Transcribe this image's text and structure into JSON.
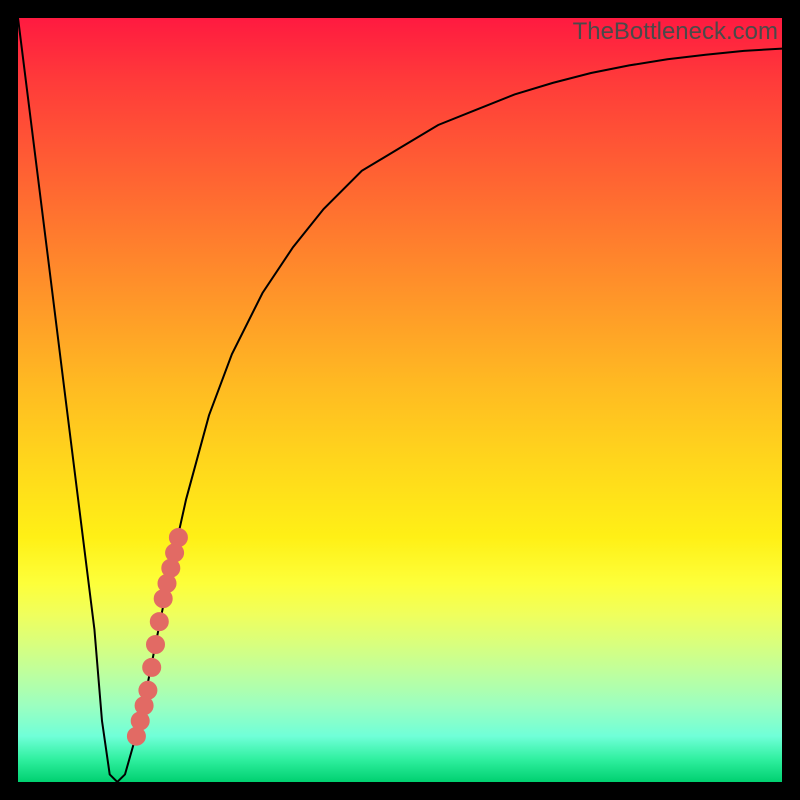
{
  "watermark": "TheBottleneck.com",
  "colors": {
    "frame": "#000000",
    "curve": "#000000",
    "dots": "#e26a64",
    "gradient_top": "#ff1a40",
    "gradient_mid": "#ffe81a",
    "gradient_bottom": "#00d070"
  },
  "chart_data": {
    "type": "line",
    "title": "",
    "xlabel": "",
    "ylabel": "",
    "xlim": [
      0,
      100
    ],
    "ylim": [
      0,
      100
    ],
    "grid": false,
    "legend": false,
    "series": [
      {
        "name": "bottleneck-curve",
        "x": [
          0,
          2,
          4,
          6,
          8,
          10,
          11,
          12,
          13,
          14,
          16,
          18,
          20,
          22,
          25,
          28,
          32,
          36,
          40,
          45,
          50,
          55,
          60,
          65,
          70,
          75,
          80,
          85,
          90,
          95,
          100
        ],
        "y": [
          100,
          84,
          68,
          52,
          36,
          20,
          8,
          1,
          0,
          1,
          8,
          18,
          28,
          37,
          48,
          56,
          64,
          70,
          75,
          80,
          83,
          86,
          88,
          90,
          91.5,
          92.8,
          93.8,
          94.6,
          95.2,
          95.7,
          96
        ]
      }
    ],
    "scatter": {
      "name": "highlighted-points",
      "points": [
        {
          "x": 15.5,
          "y": 6
        },
        {
          "x": 16.0,
          "y": 8
        },
        {
          "x": 16.5,
          "y": 10
        },
        {
          "x": 17.0,
          "y": 12
        },
        {
          "x": 17.5,
          "y": 15
        },
        {
          "x": 18.0,
          "y": 18
        },
        {
          "x": 18.5,
          "y": 21
        },
        {
          "x": 19.0,
          "y": 24
        },
        {
          "x": 19.5,
          "y": 26
        },
        {
          "x": 20.0,
          "y": 28
        },
        {
          "x": 20.5,
          "y": 30
        },
        {
          "x": 21.0,
          "y": 32
        }
      ]
    }
  }
}
